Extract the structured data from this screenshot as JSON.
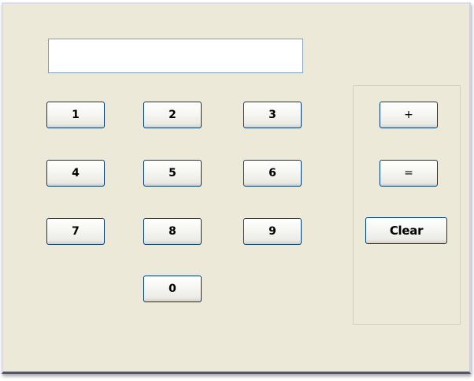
{
  "calculator": {
    "display_value": "",
    "digits": [
      {
        "label": "1"
      },
      {
        "label": "2"
      },
      {
        "label": "3"
      },
      {
        "label": "4"
      },
      {
        "label": "5"
      },
      {
        "label": "6"
      },
      {
        "label": "7"
      },
      {
        "label": "8"
      },
      {
        "label": "9"
      },
      {
        "label": "0"
      }
    ],
    "operators": {
      "plus_label": "+",
      "equals_label": "=",
      "clear_label": "Clear"
    }
  },
  "colors": {
    "panel_background": "#ece9d8",
    "button_border": "#003c74",
    "display_border": "#7f9db9"
  }
}
